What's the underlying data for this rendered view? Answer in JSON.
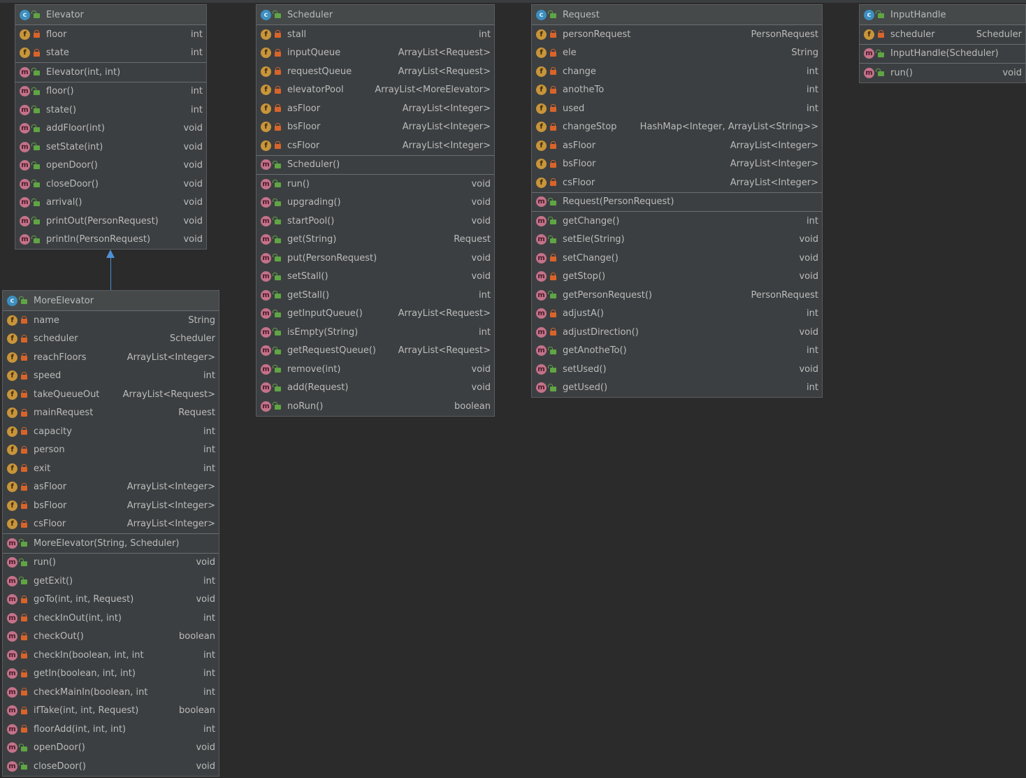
{
  "classes": [
    {
      "name": "Elevator",
      "fields": [
        {
          "name": "floor",
          "type": "int",
          "vis": "private"
        },
        {
          "name": "state",
          "type": "int",
          "vis": "private"
        }
      ],
      "constructors": [
        {
          "name": "Elevator(int, int)",
          "type": "",
          "vis": "public"
        }
      ],
      "methods": [
        {
          "name": "floor()",
          "type": "int",
          "vis": "public"
        },
        {
          "name": "state()",
          "type": "int",
          "vis": "public"
        },
        {
          "name": "addFloor(int)",
          "type": "void",
          "vis": "public"
        },
        {
          "name": "setState(int)",
          "type": "void",
          "vis": "public"
        },
        {
          "name": "openDoor()",
          "type": "void",
          "vis": "public"
        },
        {
          "name": "closeDoor()",
          "type": "void",
          "vis": "public"
        },
        {
          "name": "arrival()",
          "type": "void",
          "vis": "public"
        },
        {
          "name": "printOut(PersonRequest)",
          "type": "void",
          "vis": "public"
        },
        {
          "name": "println(PersonRequest)",
          "type": "void",
          "vis": "public"
        }
      ]
    },
    {
      "name": "Scheduler",
      "fields": [
        {
          "name": "stall",
          "type": "int",
          "vis": "private"
        },
        {
          "name": "inputQueue",
          "type": "ArrayList<Request>",
          "vis": "private"
        },
        {
          "name": "requestQueue",
          "type": "ArrayList<Request>",
          "vis": "private"
        },
        {
          "name": "elevatorPool",
          "type": "ArrayList<MoreElevator>",
          "vis": "private"
        },
        {
          "name": "asFloor",
          "type": "ArrayList<Integer>",
          "vis": "private"
        },
        {
          "name": "bsFloor",
          "type": "ArrayList<Integer>",
          "vis": "private"
        },
        {
          "name": "csFloor",
          "type": "ArrayList<Integer>",
          "vis": "private"
        }
      ],
      "constructors": [
        {
          "name": "Scheduler()",
          "type": "",
          "vis": "public"
        }
      ],
      "methods": [
        {
          "name": "run()",
          "type": "void",
          "vis": "public"
        },
        {
          "name": "upgrading()",
          "type": "void",
          "vis": "public"
        },
        {
          "name": "startPool()",
          "type": "void",
          "vis": "public"
        },
        {
          "name": "get(String)",
          "type": "Request",
          "vis": "public"
        },
        {
          "name": "put(PersonRequest)",
          "type": "void",
          "vis": "public"
        },
        {
          "name": "setStall()",
          "type": "void",
          "vis": "public"
        },
        {
          "name": "getStall()",
          "type": "int",
          "vis": "public"
        },
        {
          "name": "getInputQueue()",
          "type": "ArrayList<Request>",
          "vis": "public"
        },
        {
          "name": "isEmpty(String)",
          "type": "int",
          "vis": "public"
        },
        {
          "name": "getRequestQueue()",
          "type": "ArrayList<Request>",
          "vis": "public"
        },
        {
          "name": "remove(int)",
          "type": "void",
          "vis": "public"
        },
        {
          "name": "add(Request)",
          "type": "void",
          "vis": "public"
        },
        {
          "name": "noRun()",
          "type": "boolean",
          "vis": "public"
        }
      ]
    },
    {
      "name": "Request",
      "fields": [
        {
          "name": "personRequest",
          "type": "PersonRequest",
          "vis": "private"
        },
        {
          "name": "ele",
          "type": "String",
          "vis": "private"
        },
        {
          "name": "change",
          "type": "int",
          "vis": "private"
        },
        {
          "name": "anotheTo",
          "type": "int",
          "vis": "private"
        },
        {
          "name": "used",
          "type": "int",
          "vis": "private"
        },
        {
          "name": "changeStop",
          "type": "HashMap<Integer, ArrayList<String>>",
          "vis": "private"
        },
        {
          "name": "asFloor",
          "type": "ArrayList<Integer>",
          "vis": "private"
        },
        {
          "name": "bsFloor",
          "type": "ArrayList<Integer>",
          "vis": "private"
        },
        {
          "name": "csFloor",
          "type": "ArrayList<Integer>",
          "vis": "private"
        }
      ],
      "constructors": [
        {
          "name": "Request(PersonRequest)",
          "type": "",
          "vis": "public"
        }
      ],
      "methods": [
        {
          "name": "getChange()",
          "type": "int",
          "vis": "public"
        },
        {
          "name": "setEle(String)",
          "type": "void",
          "vis": "public"
        },
        {
          "name": "setChange()",
          "type": "void",
          "vis": "private"
        },
        {
          "name": "getStop()",
          "type": "void",
          "vis": "private"
        },
        {
          "name": "getPersonRequest()",
          "type": "PersonRequest",
          "vis": "public"
        },
        {
          "name": "adjustA()",
          "type": "int",
          "vis": "private"
        },
        {
          "name": "adjustDirection()",
          "type": "void",
          "vis": "private"
        },
        {
          "name": "getAnotheTo()",
          "type": "int",
          "vis": "public"
        },
        {
          "name": "setUsed()",
          "type": "void",
          "vis": "public"
        },
        {
          "name": "getUsed()",
          "type": "int",
          "vis": "public"
        }
      ]
    },
    {
      "name": "InputHandle",
      "fields": [
        {
          "name": "scheduler",
          "type": "Scheduler",
          "vis": "private"
        }
      ],
      "constructors": [
        {
          "name": "InputHandle(Scheduler)",
          "type": "",
          "vis": "public"
        }
      ],
      "methods": [
        {
          "name": "run()",
          "type": "void",
          "vis": "public"
        }
      ]
    },
    {
      "name": "MoreElevator",
      "fields": [
        {
          "name": "name",
          "type": "String",
          "vis": "private"
        },
        {
          "name": "scheduler",
          "type": "Scheduler",
          "vis": "private"
        },
        {
          "name": "reachFloors",
          "type": "ArrayList<Integer>",
          "vis": "private"
        },
        {
          "name": "speed",
          "type": "int",
          "vis": "private"
        },
        {
          "name": "takeQueueOut",
          "type": "ArrayList<Request>",
          "vis": "private"
        },
        {
          "name": "mainRequest",
          "type": "Request",
          "vis": "private"
        },
        {
          "name": "capacity",
          "type": "int",
          "vis": "private"
        },
        {
          "name": "person",
          "type": "int",
          "vis": "private"
        },
        {
          "name": "exit",
          "type": "int",
          "vis": "private"
        },
        {
          "name": "asFloor",
          "type": "ArrayList<Integer>",
          "vis": "private"
        },
        {
          "name": "bsFloor",
          "type": "ArrayList<Integer>",
          "vis": "private"
        },
        {
          "name": "csFloor",
          "type": "ArrayList<Integer>",
          "vis": "private"
        }
      ],
      "constructors": [
        {
          "name": "MoreElevator(String, Scheduler)",
          "type": "",
          "vis": "public"
        }
      ],
      "methods": [
        {
          "name": "run()",
          "type": "void",
          "vis": "public"
        },
        {
          "name": "getExit()",
          "type": "int",
          "vis": "public"
        },
        {
          "name": "goTo(int, int, Request)",
          "type": "void",
          "vis": "private"
        },
        {
          "name": "checkInOut(int, int)",
          "type": "int",
          "vis": "private"
        },
        {
          "name": "checkOut()",
          "type": "boolean",
          "vis": "private"
        },
        {
          "name": "checkIn(boolean, int, int",
          "type": "int",
          "vis": "private"
        },
        {
          "name": "getIn(boolean, int, int)",
          "type": "int",
          "vis": "private"
        },
        {
          "name": "checkMainIn(boolean, int",
          "type": "int",
          "vis": "private"
        },
        {
          "name": "ifTake(int, int, Request)",
          "type": "boolean",
          "vis": "private"
        },
        {
          "name": "floorAdd(int, int, int)",
          "type": "int",
          "vis": "private"
        },
        {
          "name": "openDoor()",
          "type": "void",
          "vis": "public"
        },
        {
          "name": "closeDoor()",
          "type": "void",
          "vis": "public"
        }
      ]
    }
  ],
  "icons": {
    "class": "c",
    "field": "f",
    "method": "m"
  },
  "relations": [
    {
      "from": "MoreElevator",
      "to": "Elevator",
      "kind": "extends"
    }
  ],
  "colors": {
    "background": "#2b2b2b",
    "box": "#3c3f41",
    "arrow": "#4f8fd6",
    "private": "#d8642a",
    "public": "#5fa544"
  }
}
